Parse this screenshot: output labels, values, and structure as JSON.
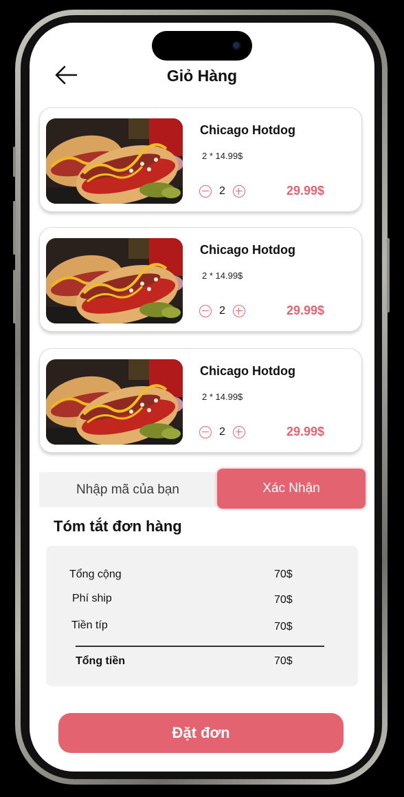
{
  "header": {
    "title": "Giỏ Hàng"
  },
  "cart": {
    "items": [
      {
        "name": "Chicago Hotdog",
        "unit_line": "2 * 14.99$",
        "quantity": "2",
        "price": "29.99$"
      },
      {
        "name": "Chicago Hotdog",
        "unit_line": "2 * 14.99$",
        "quantity": "2",
        "price": "29.99$"
      },
      {
        "name": "Chicago Hotdog",
        "unit_line": "2 * 14.99$",
        "quantity": "2",
        "price": "29.99$"
      }
    ]
  },
  "promo": {
    "placeholder": "Nhập mã của bạn",
    "confirm_label": "Xác Nhận"
  },
  "summary": {
    "title": "Tóm tắt đơn hàng",
    "rows": [
      {
        "label": "Tổng cộng",
        "value": "70$"
      },
      {
        "label": "Phí ship",
        "value": "70$"
      },
      {
        "label": "Tiền típ",
        "value": "70$"
      }
    ],
    "total": {
      "label": "Tổng tiền",
      "value": "70$"
    }
  },
  "actions": {
    "order_label": "Đặt đơn"
  },
  "colors": {
    "accent": "#e36470",
    "panel": "#f2f2f2"
  }
}
